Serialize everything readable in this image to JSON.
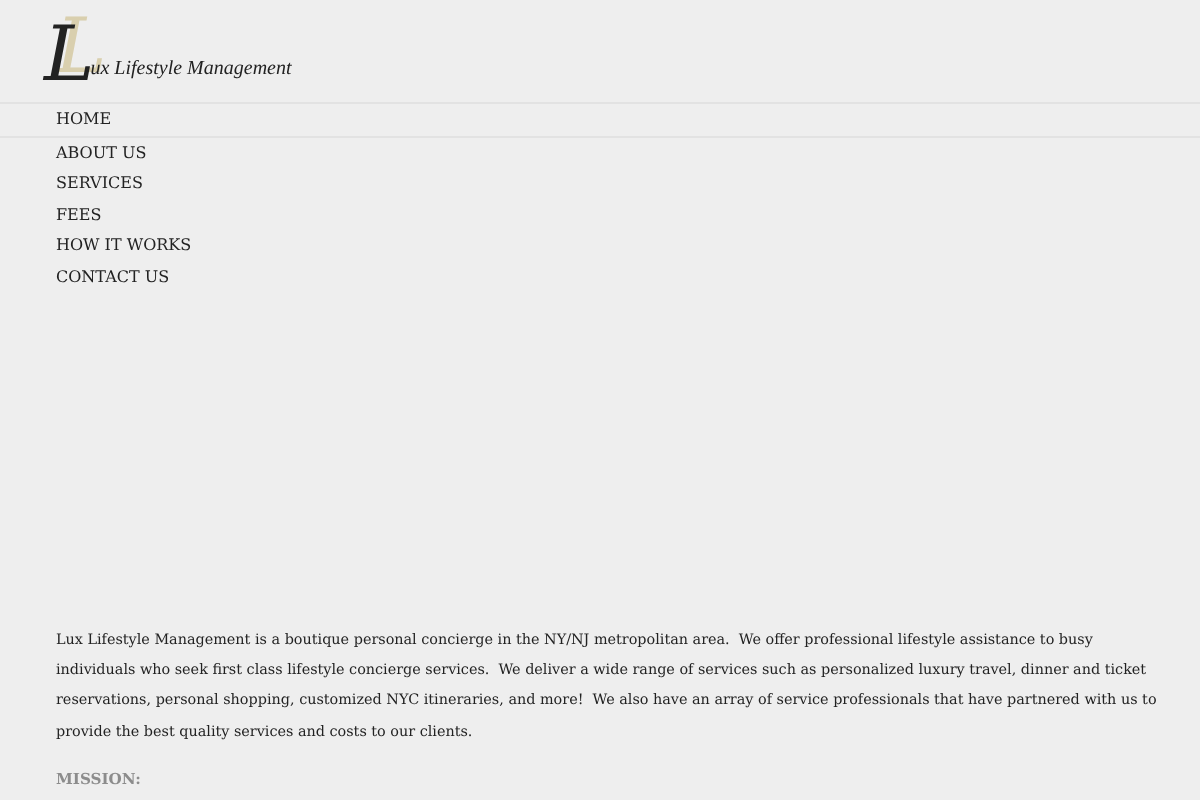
{
  "logo": {
    "initial": "L",
    "text": "ux Lifestyle Management"
  },
  "nav": [
    {
      "label": "HOME",
      "selected": true
    },
    {
      "label": "ABOUT US",
      "selected": false
    },
    {
      "label": "SERVICES",
      "selected": false
    },
    {
      "label": "FEES",
      "selected": false
    },
    {
      "label": "HOW IT WORKS",
      "selected": false
    },
    {
      "label": "CONTACT US",
      "selected": false
    }
  ],
  "intro": "Lux Lifestyle Management is a boutique personal concierge in the NY/NJ metropolitan area.  We offer professional lifestyle assistance to busy individuals who seek first class lifestyle concierge services.  We deliver a wide range of services such as personalized luxury travel, dinner and ticket reservations, personal shopping, customized NYC itineraries, and more!  We also have an array of service professionals that have partnered with us to provide the best quality services and costs to our clients.",
  "section_heading": "MISSION:"
}
